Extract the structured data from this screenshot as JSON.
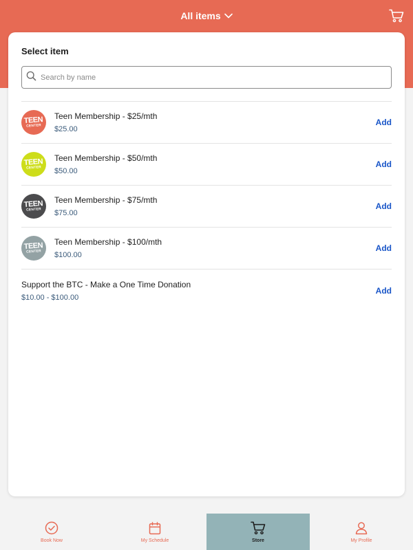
{
  "colors": {
    "brand": "#e76a54",
    "active_tab": "#93b3b7",
    "link": "#1a56c8",
    "price": "#3a5a7a"
  },
  "header": {
    "title": "All items",
    "cart_icon": "cart-icon"
  },
  "card": {
    "title": "Select item",
    "search": {
      "placeholder": "Search by name",
      "value": ""
    }
  },
  "items": [
    {
      "name": "Teen Membership - $25/mth",
      "price": "$25.00",
      "action": "Add",
      "thumb_color": "#e76a54",
      "logo_big": "TEEN",
      "logo_small": "CENTER"
    },
    {
      "name": "Teen Membership - $50/mth",
      "price": "$50.00",
      "action": "Add",
      "thumb_color": "#cddd1a",
      "logo_big": "TEEN",
      "logo_small": "CENTER"
    },
    {
      "name": "Teen Membership - $75/mth",
      "price": "$75.00",
      "action": "Add",
      "thumb_color": "#4b4b4d",
      "logo_big": "TEEN",
      "logo_small": "CENTER"
    },
    {
      "name": "Teen Membership - $100/mth",
      "price": "$100.00",
      "action": "Add",
      "thumb_color": "#93a2a4",
      "logo_big": "TEEN",
      "logo_small": "CENTER"
    },
    {
      "name": "Support the BTC - Make a One Time Donation",
      "price": "$10.00 - $100.00",
      "action": "Add"
    }
  ],
  "bottom_nav": [
    {
      "label": "Book Now",
      "icon": "check-circle-icon",
      "active": false
    },
    {
      "label": "My Schedule",
      "icon": "calendar-icon",
      "active": false
    },
    {
      "label": "Store",
      "icon": "cart-icon",
      "active": true
    },
    {
      "label": "My Profile",
      "icon": "user-icon",
      "active": false
    }
  ]
}
